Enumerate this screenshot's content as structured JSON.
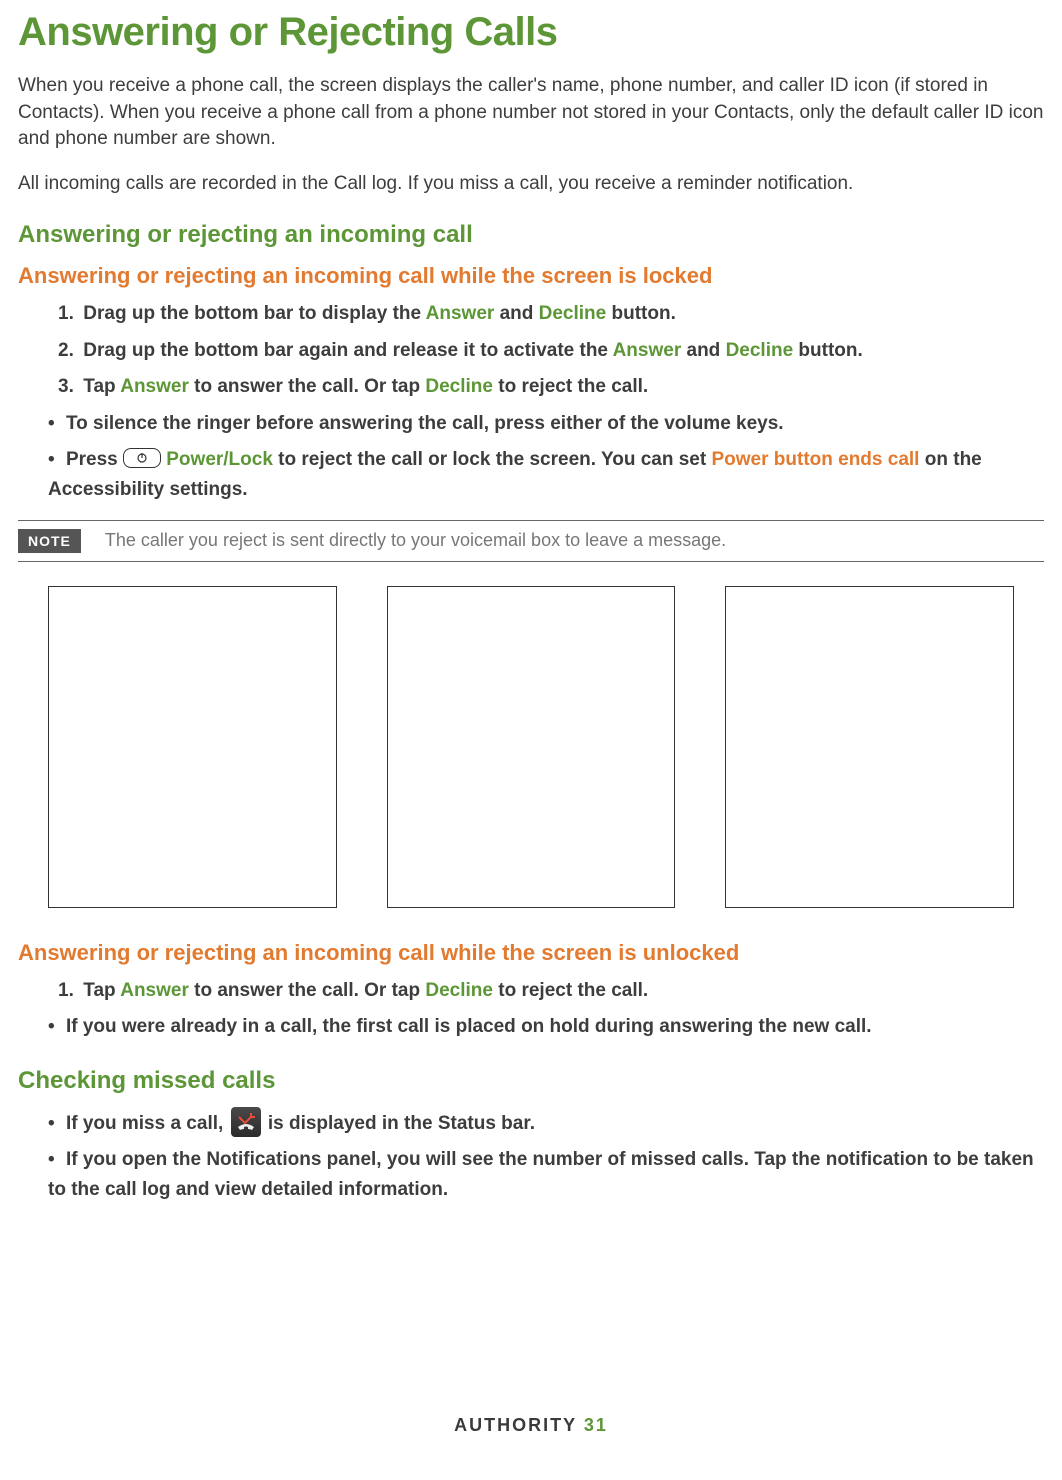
{
  "title": "Answering or Rejecting Calls",
  "intro_p1": "When you receive a phone call, the screen displays the caller's name, phone number, and caller ID icon (if stored in Contacts). When you receive a phone call from a phone number not stored in your Contacts, only the default caller ID icon and phone number are shown.",
  "intro_p2": "All incoming calls are recorded in the Call log. If you miss a call, you receive a reminder notification.",
  "section_a": {
    "heading": "Answering or rejecting an incoming call",
    "locked": {
      "heading": "Answering or rejecting an incoming call while the screen is locked",
      "steps": {
        "s1": {
          "num": "1.",
          "a": "Drag up the bottom bar to display the ",
          "answer": "Answer",
          "b": " and ",
          "decline": "Decline",
          "c": " button."
        },
        "s2": {
          "num": "2.",
          "a": "Drag up the bottom bar again and release it to activate the ",
          "answer": "Answer",
          "b": " and ",
          "decline": "Decline",
          "c": " button."
        },
        "s3": {
          "num": "3.",
          "a": "Tap ",
          "answer": "Answer",
          "b": " to answer the call. Or tap ",
          "decline": "Decline",
          "c": " to reject the call."
        }
      },
      "bullets": {
        "b1": "To silence the ringer before answering the call, press either of the volume keys.",
        "b2": {
          "a": "Press ",
          "power": " Power/Lock",
          "b": " to reject the call or lock the screen. You can set ",
          "setting": "Power button ends call",
          "c": " on the Accessibility settings."
        }
      }
    },
    "note": {
      "label": "NOTE",
      "text": "The caller you reject is sent directly to your voicemail box to leave a message."
    },
    "unlocked": {
      "heading": "Answering or rejecting an incoming call while the screen is unlocked",
      "step1": {
        "num": "1.",
        "a": "Tap ",
        "answer": "Answer",
        "b": " to answer the call. Or tap ",
        "decline": "Decline",
        "c": " to reject the call."
      },
      "bullet1": "If you were already in a call, the first call is placed on hold during answering the new call."
    }
  },
  "section_b": {
    "heading": "Checking missed calls",
    "b1": {
      "a": "If you miss a call, ",
      "b": " is displayed in the Status bar."
    },
    "b2": "If you open the Notifications panel, you will see the number of missed calls. Tap the notification to be taken to the call log and view detailed information."
  },
  "footer": {
    "brand": "AUTHORITY",
    "page": "31"
  }
}
